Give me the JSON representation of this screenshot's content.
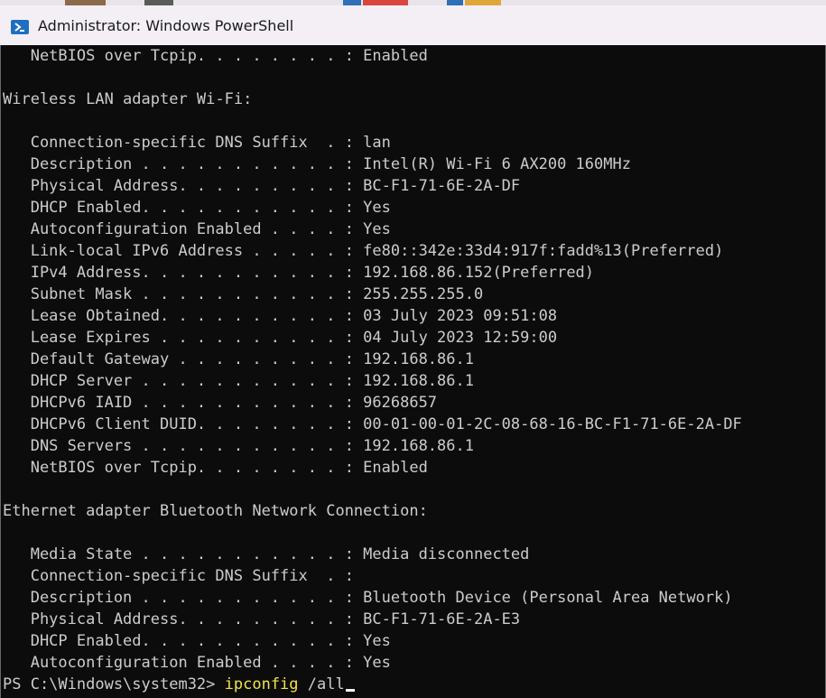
{
  "window": {
    "title": "Administrator: Windows PowerShell",
    "icon": "powershell-icon",
    "colors": {
      "titlebar": "#f3eff5",
      "console_bg": "#0c0c0c",
      "text": "#cccccc",
      "command": "#f0e34a"
    }
  },
  "console": {
    "lines": [
      "   NetBIOS over Tcpip. . . . . . . . : Enabled",
      "",
      "Wireless LAN adapter Wi-Fi:",
      "",
      "   Connection-specific DNS Suffix  . : lan",
      "   Description . . . . . . . . . . . : Intel(R) Wi-Fi 6 AX200 160MHz",
      "   Physical Address. . . . . . . . . : BC-F1-71-6E-2A-DF",
      "   DHCP Enabled. . . . . . . . . . . : Yes",
      "   Autoconfiguration Enabled . . . . : Yes",
      "   Link-local IPv6 Address . . . . . : fe80::342e:33d4:917f:fadd%13(Preferred)",
      "   IPv4 Address. . . . . . . . . . . : 192.168.86.152(Preferred)",
      "   Subnet Mask . . . . . . . . . . . : 255.255.255.0",
      "   Lease Obtained. . . . . . . . . . : 03 July 2023 09:51:08",
      "   Lease Expires . . . . . . . . . . : 04 July 2023 12:59:00",
      "   Default Gateway . . . . . . . . . : 192.168.86.1",
      "   DHCP Server . . . . . . . . . . . : 192.168.86.1",
      "   DHCPv6 IAID . . . . . . . . . . . : 96268657",
      "   DHCPv6 Client DUID. . . . . . . . : 00-01-00-01-2C-08-68-16-BC-F1-71-6E-2A-DF",
      "   DNS Servers . . . . . . . . . . . : 192.168.86.1",
      "   NetBIOS over Tcpip. . . . . . . . : Enabled",
      "",
      "Ethernet adapter Bluetooth Network Connection:",
      "",
      "   Media State . . . . . . . . . . . : Media disconnected",
      "   Connection-specific DNS Suffix  . :",
      "   Description . . . . . . . . . . . : Bluetooth Device (Personal Area Network)",
      "   Physical Address. . . . . . . . . : BC-F1-71-6E-2A-E3",
      "   DHCP Enabled. . . . . . . . . . . : Yes",
      "   Autoconfiguration Enabled . . . . : Yes"
    ],
    "prompt": {
      "path": "PS C:\\Windows\\system32> ",
      "command": "ipconfig",
      "args": " /all"
    }
  }
}
